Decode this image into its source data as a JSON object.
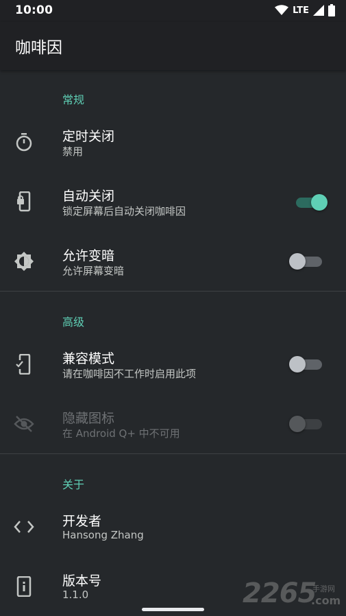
{
  "status_bar": {
    "time": "10:00",
    "network": "LTE"
  },
  "app_bar": {
    "title": "咖啡因"
  },
  "sections": {
    "general": {
      "header": "常规",
      "items": {
        "timeout": {
          "title": "定时关闭",
          "summary": "禁用",
          "icon": "timer-icon"
        },
        "auto_off": {
          "title": "自动关闭",
          "summary": "锁定屏幕后自动关闭咖啡因",
          "icon": "phone-lock-icon",
          "switch_on": true
        },
        "allow_dim": {
          "title": "允许变暗",
          "summary": "允许屏幕变暗",
          "icon": "brightness-icon",
          "switch_on": false
        }
      }
    },
    "advanced": {
      "header": "高级",
      "items": {
        "compat_mode": {
          "title": "兼容模式",
          "summary": "请在咖啡因不工作时启用此项",
          "icon": "phone-check-icon",
          "switch_on": false
        },
        "hide_icon": {
          "title": "隐藏图标",
          "summary": "在 Android Q+ 中不可用",
          "icon": "eye-off-icon",
          "switch_on": false,
          "disabled": true
        }
      }
    },
    "about": {
      "header": "关于",
      "items": {
        "developer": {
          "title": "开发者",
          "summary": "Hansong Zhang",
          "icon": "code-icon"
        },
        "version": {
          "title": "版本号",
          "summary": "1.1.0",
          "icon": "info-icon"
        }
      }
    }
  },
  "watermark": {
    "number": "2265",
    "small": "手游网",
    "domain": ".com"
  },
  "colors": {
    "accent": "#5fcfb5",
    "background": "#25282b",
    "app_bar": "#202124"
  }
}
